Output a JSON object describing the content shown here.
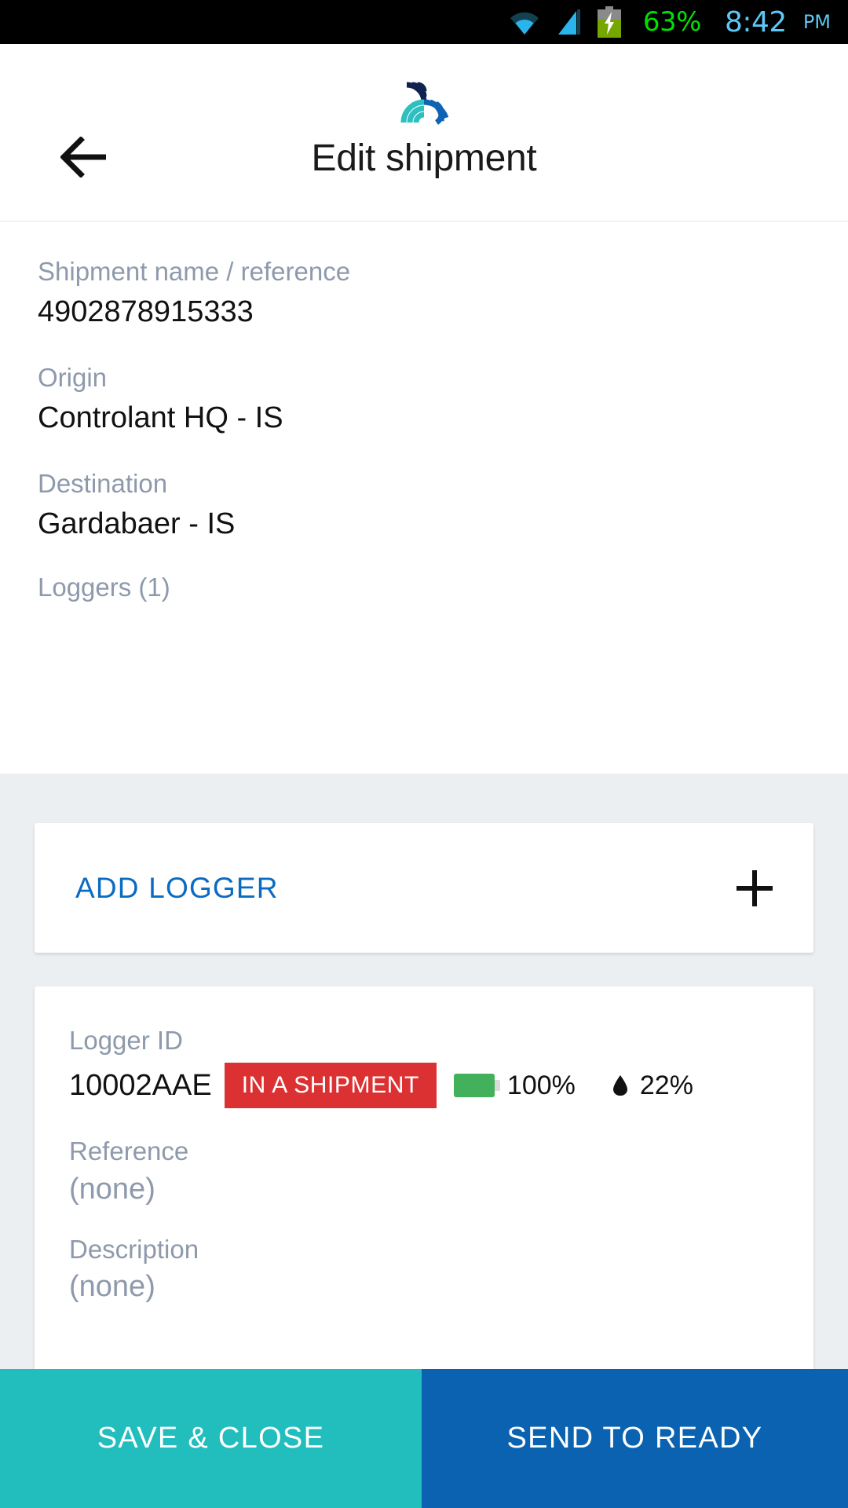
{
  "statusbar": {
    "wifi_icon": "wifi-icon",
    "signal_icon": "signal-bars-icon",
    "battery_icon": "battery-charging-icon",
    "battery_percent": "63%",
    "time": "8:42",
    "ampm": "PM",
    "battery_color": "#00e000",
    "time_color": "#5BC8F5"
  },
  "header": {
    "back_icon": "back-arrow-icon",
    "logo_icon": "controlant-logo-icon",
    "title": "Edit shipment",
    "logo_colors": {
      "navy": "#10224E",
      "blue": "#0E63B4",
      "teal": "#2EBFC0"
    }
  },
  "form": {
    "fields": [
      {
        "label": "Shipment name / reference",
        "value": "4902878915333"
      },
      {
        "label": "Origin",
        "value": "Controlant HQ - IS"
      },
      {
        "label": "Destination",
        "value": "Gardabaer - IS"
      }
    ],
    "loggers_label": "Loggers (1)"
  },
  "add_logger": {
    "label": "ADD LOGGER",
    "icon": "plus-icon",
    "color": "#0B6BC2"
  },
  "logger_card": {
    "id_label": "Logger ID",
    "id_value": "10002AAE",
    "status_badge": "IN A SHIPMENT",
    "status_badge_color": "#DC3132",
    "battery_icon": "battery-icon",
    "battery_value": "100%",
    "battery_color": "#43B05C",
    "humidity_icon": "water-drop-icon",
    "humidity_value": "22%",
    "reference_label": "Reference",
    "reference_value": "(none)",
    "description_label": "Description",
    "description_value": "(none)"
  },
  "bottom_bar": {
    "save_label": "SAVE & CLOSE",
    "save_color": "#22BDBD",
    "send_label": "SEND TO READY",
    "send_color": "#0A62B0"
  }
}
